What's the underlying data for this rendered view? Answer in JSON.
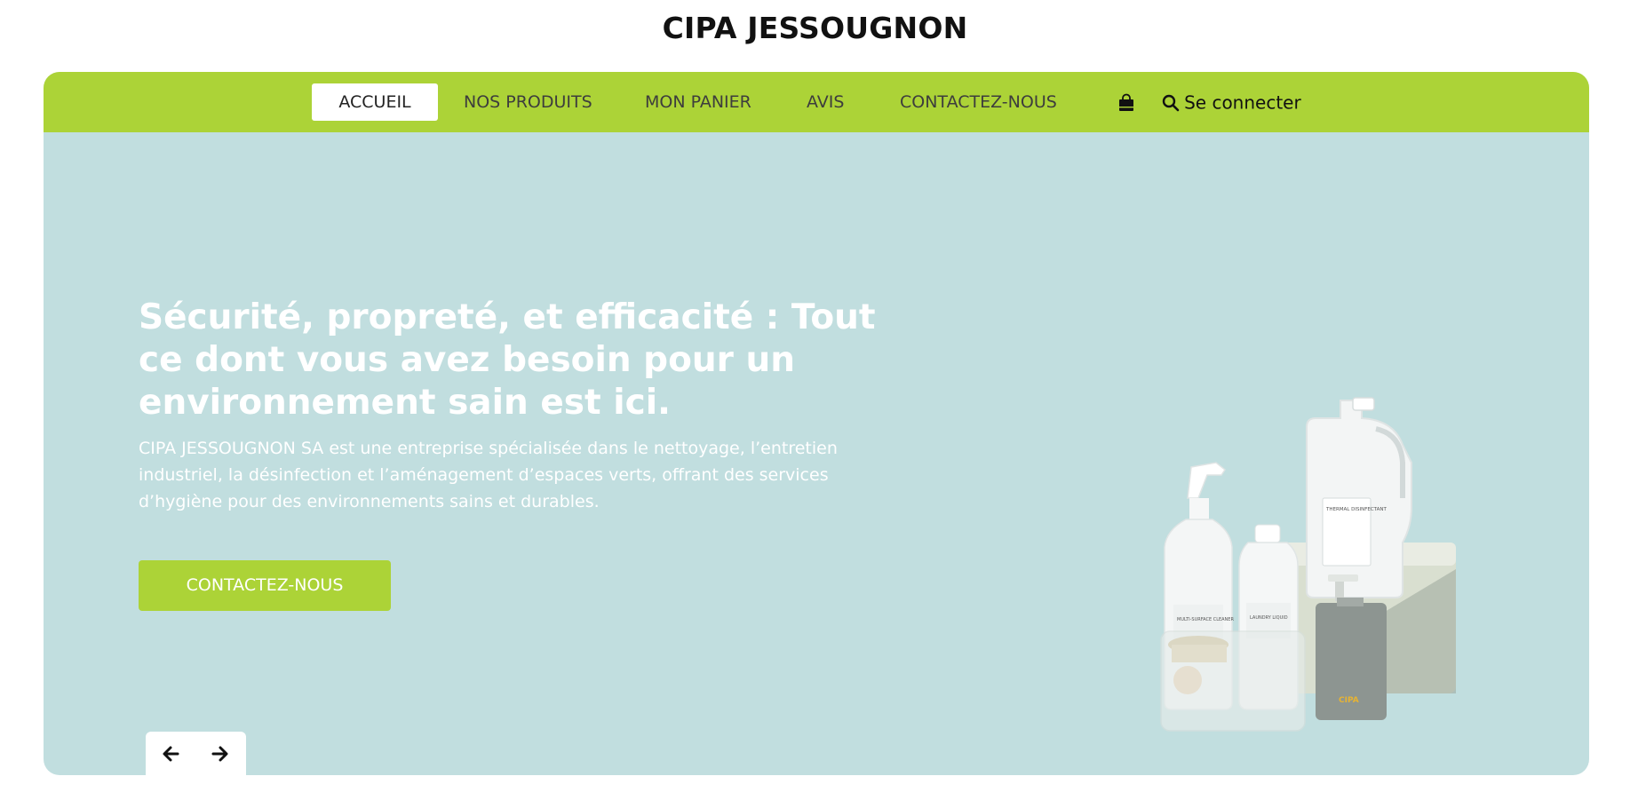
{
  "brand": {
    "title": "CIPA JESSOUGNON"
  },
  "nav": {
    "items": [
      {
        "label": "ACCUEIL",
        "active": true
      },
      {
        "label": "NOS PRODUITS"
      },
      {
        "label": "MON PANIER"
      },
      {
        "label": "AVIS"
      },
      {
        "label": "CONTACTEZ-NOUS"
      }
    ],
    "cart_icon": "shopping-bag-icon",
    "search_icon": "search-icon",
    "login_label": "Se connecter"
  },
  "hero": {
    "title": "Sécurité, propreté, et efficacité : Tout ce dont vous avez besoin pour un environnement sain est ici.",
    "text": "CIPA JESSOUGNON SA est une entreprise spécialisée dans le nettoyage, l’entretien industriel, la désinfection et l’aménagement d’espaces verts, offrant des services d’hygiène pour des environnements sains et durables.",
    "cta_label": "CONTACTEZ-NOUS",
    "image": {
      "bottle_label": "THERMAL DISINFECTANT",
      "spray_label": "MULTI-SURFACE CLEANER",
      "laundry_label": "LAUNDRY LIQUID",
      "logo_text": "CIPA"
    }
  },
  "slider": {
    "prev_icon": "arrow-left-icon",
    "next_icon": "arrow-right-icon"
  },
  "colors": {
    "accent": "#acd337",
    "hero_bg": "#c1dedf",
    "text_dark": "#111111"
  }
}
